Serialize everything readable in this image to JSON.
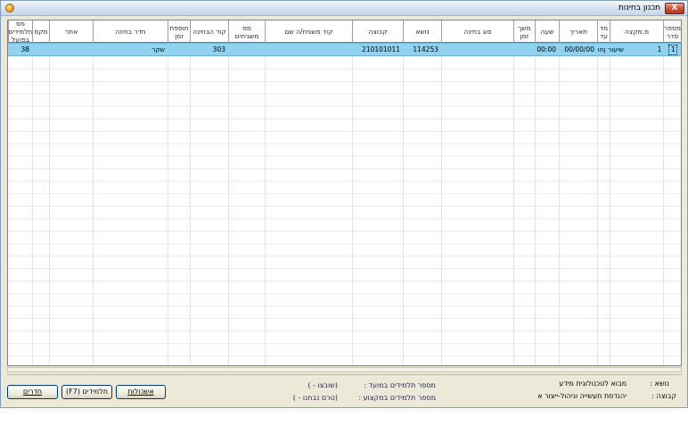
{
  "window": {
    "title": "תכנון בחינות",
    "close_label": "X"
  },
  "grid": {
    "columns": [
      {
        "key": "serial",
        "label": "מספר סדר"
      },
      {
        "key": "seq",
        "label": "מ.מקצה"
      },
      {
        "key": "until",
        "label": "מד עד"
      },
      {
        "key": "date",
        "label": "תאריך"
      },
      {
        "key": "time",
        "label": "שעה"
      },
      {
        "key": "duration",
        "label": "משך זמן"
      },
      {
        "key": "exam_type",
        "label": "סוג בחינה"
      },
      {
        "key": "subject",
        "label": "נושא"
      },
      {
        "key": "group",
        "label": "קבוצה"
      },
      {
        "key": "supervisor_code",
        "label": "קוד משגיח/ה  שם"
      },
      {
        "key": "supervisor_count",
        "label": "מס משגיחים"
      },
      {
        "key": "exam_code",
        "label": "קוד הבחינה"
      },
      {
        "key": "extra_time",
        "label": "תוספת זמן"
      },
      {
        "key": "exam_room",
        "label": "חדר בחינה"
      },
      {
        "key": "site",
        "label": "אתר"
      },
      {
        "key": "max_students",
        "label": "מקס"
      },
      {
        "key": "actual_students",
        "label": "מס תלמידים בפועל"
      }
    ],
    "rows": [
      {
        "serial": "1",
        "seq": "1",
        "until": "שיעור ןחו",
        "date": "00/00/00",
        "time": "00:00",
        "duration": "",
        "exam_type": "",
        "subject": "114253",
        "group": "210101011",
        "supervisor_code": "",
        "supervisor_count": "",
        "exam_code": "303",
        "extra_time": "",
        "exam_room": "שקר",
        "site": "",
        "max_students": "",
        "actual_students": "38"
      }
    ]
  },
  "footer": {
    "subject_label": "נושא :",
    "subject_value": "מבוא לטכנולוגית מידע",
    "group_label": "קבוצה :",
    "group_value": "יהנדסת תעשייה וניהול-ייצור א",
    "students_in_session_label": "מספר תלמידים במועד :",
    "students_in_session_value": "(שובצו     -          )",
    "students_in_group_label": "מספר תלמידים במקצוע :",
    "students_in_group_value": "(טרם נבחנו -         )",
    "btn_approvals": "אשכולות",
    "btn_students": "תלמידים (F7)",
    "btn_rooms": "חדרים"
  }
}
